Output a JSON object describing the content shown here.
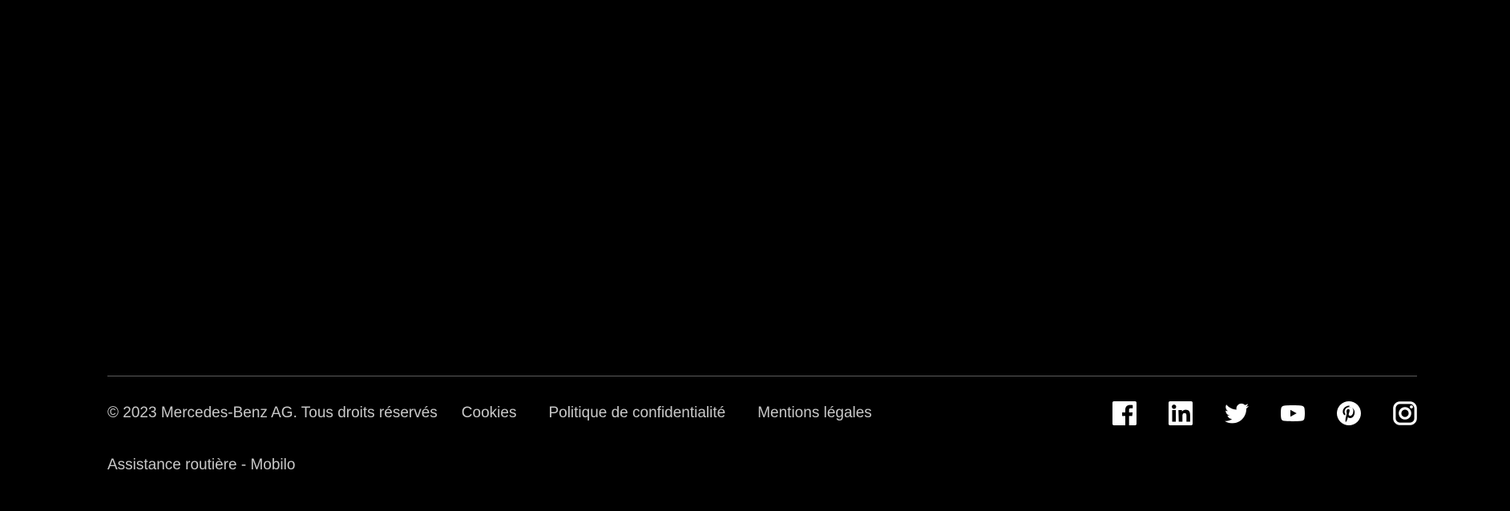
{
  "footer": {
    "copyright": "© 2023 Mercedes-Benz AG. Tous droits réservés",
    "links": {
      "cookies": "Cookies",
      "privacy": "Politique de confidentialité",
      "legal_notice": "Mentions légales",
      "roadside": "Assistance routière - Mobilo"
    },
    "social_icons": [
      "facebook-icon",
      "linkedin-icon",
      "twitter-icon",
      "youtube-icon",
      "pinterest-icon",
      "instagram-icon"
    ]
  },
  "colors": {
    "background": "#000000",
    "text": "#c8c8c8",
    "divider": "#5c5c5c",
    "icon": "#ffffff"
  }
}
